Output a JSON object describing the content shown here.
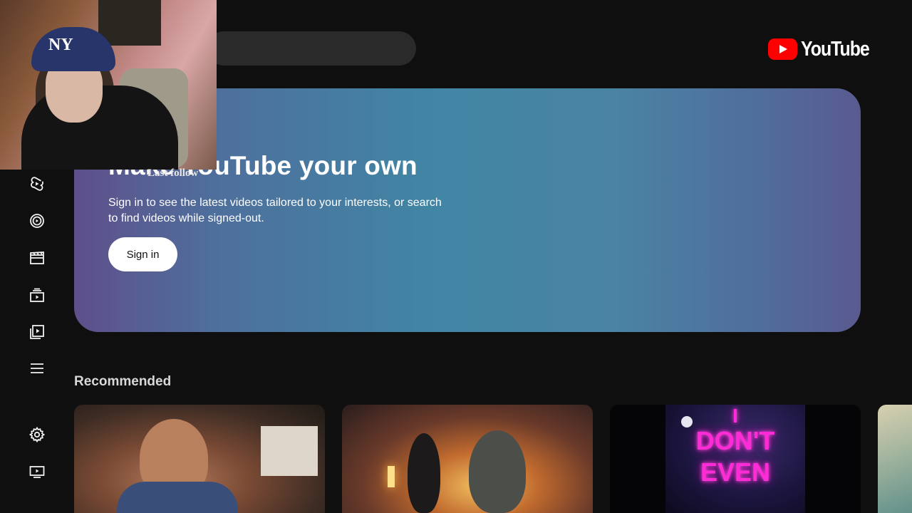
{
  "header": {
    "logo_text": "YouTube"
  },
  "hero": {
    "title": "Make YouTube your own",
    "description": "Sign in to see the latest videos tailored to your interests, or search to find videos while signed-out.",
    "signin_label": "Sign in"
  },
  "overlay": {
    "caption": "Last follow"
  },
  "recommended": {
    "title": "Recommended",
    "thumbnails": [
      {
        "art": "man-smiling-in-bar"
      },
      {
        "art": "two-performers-graffiti-wall"
      },
      {
        "art": "neon-text",
        "neon_lines": [
          "I",
          "DON'T",
          "EVEN"
        ]
      },
      {
        "art": "partial-thumbnail"
      }
    ]
  },
  "sidebar": {
    "items": [
      {
        "icon": "shorts-icon"
      },
      {
        "icon": "subscriptions-icon"
      },
      {
        "icon": "movies-icon"
      },
      {
        "icon": "library-icon"
      },
      {
        "icon": "playlist-icon"
      },
      {
        "icon": "menu-icon"
      },
      {
        "icon": "settings-icon"
      },
      {
        "icon": "cast-icon"
      }
    ]
  },
  "colors": {
    "background": "#0f0f0f",
    "brand_red": "#ff0000",
    "neon_pink": "#ff2bd6"
  }
}
